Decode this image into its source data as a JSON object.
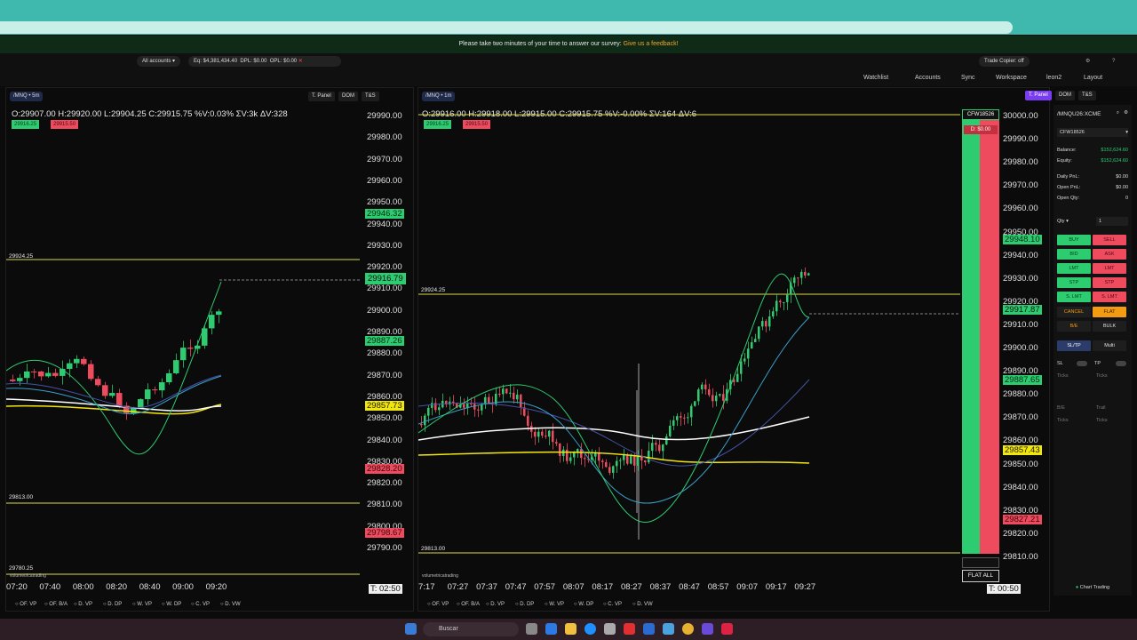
{
  "survey": {
    "text": "Please take two minutes of your time to answer our survey:",
    "link": "Give us a feedback!"
  },
  "toolbar": {
    "accounts_select": "All accounts",
    "eq": "Eq: $4,381,434.40",
    "dpl": "DPL: $0.00",
    "opl": "OPL: $0.00",
    "trade_copier": "Trade Copier: off",
    "watchlist": "Watchlist",
    "accounts": "Accounts",
    "sync": "Sync",
    "workspace": "Workspace",
    "user": "leon2",
    "layout": "Layout"
  },
  "left_chart": {
    "symbol": "/MNQ",
    "interval": "5m",
    "tabs": [
      "T. Panel",
      "DOM",
      "T&S"
    ],
    "ohlc": "O:29907.00  H:29920.00  L:29904.25  C:29915.75  %V:0.03%  ΣV:3k  ΔV:328",
    "bid_chip": "29916.25",
    "ask_chip": "29915.50",
    "price_ticks": [
      "29990.00",
      "29980.00",
      "29970.00",
      "29960.00",
      "29950.00",
      "29940.00",
      "29930.00",
      "29920.00",
      "29910.00",
      "29900.00",
      "29890.00",
      "29880.00",
      "29870.00",
      "29860.00",
      "29850.00",
      "29840.00",
      "29830.00",
      "29820.00",
      "29810.00",
      "29800.00",
      "29790.00"
    ],
    "tags": {
      "t1": "29946.32",
      "t2": "29916.79",
      "t3": "29887.26",
      "t4": "29857.73",
      "t5": "29828.20",
      "t6": "29798.67"
    },
    "levels": {
      "l1": "29924.25",
      "l2": "29813.00",
      "l3": "29780.25"
    },
    "time_ticks": [
      "07:20",
      "07:40",
      "08:00",
      "08:20",
      "08:40",
      "09:00",
      "09:20"
    ],
    "timer": "T: 02:50",
    "brand": "volumetricatrading",
    "options": [
      "OF. VP",
      "OF. B/A",
      "D. VP",
      "D. DP",
      "W. VP",
      "W. DP",
      "C. VP",
      "D. VW"
    ]
  },
  "right_chart": {
    "symbol": "/MNQ",
    "interval": "1m",
    "tabs": [
      "T. Panel",
      "DOM",
      "T&S"
    ],
    "ohlc": "O:29916.00  H:29918.00  L:29915.00  C:29915.75  %V:-0.00%  ΣV:164  ΔV:6",
    "bid_chip": "29916.25",
    "ask_chip": "29915.50",
    "price_ticks": [
      "30000.00",
      "29990.00",
      "29980.00",
      "29970.00",
      "29960.00",
      "29950.00",
      "29940.00",
      "29930.00",
      "29920.00",
      "29910.00",
      "29900.00",
      "29890.00",
      "29880.00",
      "29870.00",
      "29860.00",
      "29850.00",
      "29840.00",
      "29830.00",
      "29820.00",
      "29810.00"
    ],
    "tags": {
      "t1": "29948.10",
      "t2": "29917.87",
      "t3": "29887.65",
      "t4": "29857.43",
      "t5": "29827.21"
    },
    "levels": {
      "l1": "29924.25",
      "l2": "29813.00"
    },
    "time_ticks": [
      "7:17",
      "07:27",
      "07:37",
      "07:47",
      "07:57",
      "08:07",
      "08:17",
      "08:27",
      "08:37",
      "08:47",
      "08:57",
      "09:07",
      "09:17",
      "09:27"
    ],
    "timer": "T: 00:50",
    "account_tag": "CFW18526",
    "dpl_tag": "D: $0.00",
    "flat_all": "FLAT ALL",
    "brand": "volumetricatrading",
    "options": [
      "OF. VP",
      "OF. B/A",
      "D. VP",
      "D. DP",
      "W. VP",
      "W. DP",
      "C. VP",
      "D. VW"
    ]
  },
  "order_panel": {
    "symbol": "/MNQU26:XCME",
    "account": "CFW18526",
    "balance_label": "Balance:",
    "balance": "$152,624.60",
    "equity_label": "Equity:",
    "equity": "$152,624.60",
    "daily_pnl_label": "Daily PnL:",
    "daily_pnl": "$0.00",
    "open_pnl_label": "Open PnL:",
    "open_pnl": "$0.00",
    "open_qty_label": "Open Qty:",
    "open_qty": "0",
    "qty_label": "Qty",
    "qty_value": "1",
    "buttons": {
      "buy": "BUY",
      "sell": "SELL",
      "bid": "BID",
      "ask": "ASK",
      "lmt_b": "LMT",
      "lmt_s": "LMT",
      "stp_b": "STP",
      "stp_s": "STP",
      "slmt_b": "S. LMT",
      "slmt_s": "S. LMT",
      "cancel": "CANCEL",
      "flat": "FLAT",
      "be": "B/E",
      "bulk": "BULK",
      "sltp": "SL/TP",
      "multi": "Multi"
    },
    "sl_label": "SL",
    "tp_label": "TP",
    "ticks_label": "Ticks",
    "be_label": "B/E",
    "trail_label": "Trail",
    "chart_trading": "Chart Trading"
  },
  "taskbar": {
    "search": "Buscar"
  },
  "colors": {
    "up": "#2ecc71",
    "down": "#ef4b5f",
    "level": "#d8d84a",
    "accent": "#7a3cf0",
    "brand_teal": "#3fb8ad"
  }
}
